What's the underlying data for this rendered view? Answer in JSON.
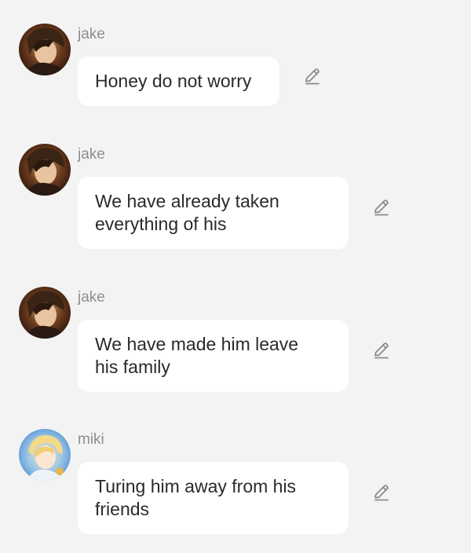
{
  "messages": [
    {
      "sender": "jake",
      "text": "Honey do not worry",
      "avatar": "jake-avatar",
      "action_icon": "pencil-edit-icon"
    },
    {
      "sender": "jake",
      "text": "We have already taken\neverything of his",
      "avatar": "jake-avatar",
      "action_icon": "pencil-edit-icon"
    },
    {
      "sender": "jake",
      "text": "We have made him leave\nhis family",
      "avatar": "jake-avatar",
      "action_icon": "pencil-edit-icon"
    },
    {
      "sender": "miki",
      "text": "Turing him away from his\nfriends",
      "avatar": "miki-avatar",
      "action_icon": "pencil-edit-icon"
    }
  ],
  "colors": {
    "background": "#f3f3f3",
    "bubble": "#ffffff",
    "sender_text": "#8e8e8e",
    "message_text": "#2a2a2a",
    "icon": "#8a8a8a"
  }
}
